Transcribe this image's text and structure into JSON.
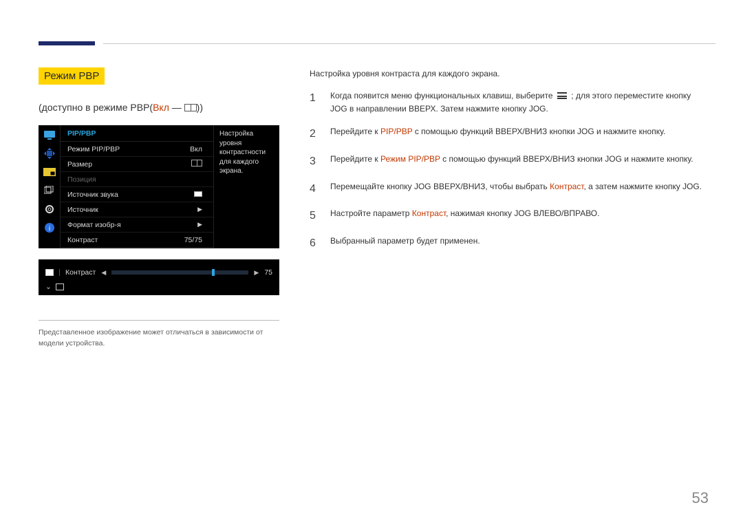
{
  "title_badge": "Режим PBP",
  "subtitle_prefix": "(доступно в режиме PBP(",
  "subtitle_mode": "Вкл",
  "subtitle_suffix": "))",
  "osd": {
    "header": "PIP/PBP",
    "rows": [
      {
        "label": "Режим PIP/PBP",
        "value": "Вкл"
      },
      {
        "label": "Размер",
        "value": ""
      },
      {
        "label": "Позиция",
        "value": ""
      },
      {
        "label": "Источник звука",
        "value": ""
      },
      {
        "label": "Источник",
        "value": ""
      },
      {
        "label": "Формат изобр-я",
        "value": ""
      },
      {
        "label": "Контраст",
        "value": "75/75"
      }
    ],
    "side_text": "Настройка уровня контрастности для каждого экрана."
  },
  "slider": {
    "label": "Контраст",
    "value": "75"
  },
  "footnote": "Представленное изображение может отличаться в зависимости от модели устройства.",
  "right": {
    "desc": "Настройка уровня контраста для каждого экрана.",
    "steps": [
      {
        "n": "1",
        "pre": "Когда появится меню функциональных клавиш, выберите ",
        "icon": true,
        "post": " ; для этого переместите кнопку JOG в направлении ВВЕРХ. Затем нажмите кнопку JOG."
      },
      {
        "n": "2",
        "pre": "Перейдите к ",
        "em": "PIP/PBP",
        "post": " с помощью функций ВВЕРХ/ВНИЗ кнопки JOG и нажмите кнопку."
      },
      {
        "n": "3",
        "pre": "Перейдите к ",
        "em": "Режим PIP/PBP",
        "post": " с помощью функций ВВЕРХ/ВНИЗ кнопки JOG и нажмите кнопку."
      },
      {
        "n": "4",
        "pre": "Перемещайте кнопку JOG ВВЕРХ/ВНИЗ, чтобы выбрать ",
        "em": "Контраст",
        "post": ", а затем нажмите кнопку JOG."
      },
      {
        "n": "5",
        "pre": "Настройте параметр ",
        "em": "Контраст",
        "post": ", нажимая кнопку JOG ВЛЕВО/ВПРАВО."
      },
      {
        "n": "6",
        "pre": "Выбранный параметр будет применен.",
        "em": "",
        "post": ""
      }
    ]
  },
  "page_number": "53"
}
